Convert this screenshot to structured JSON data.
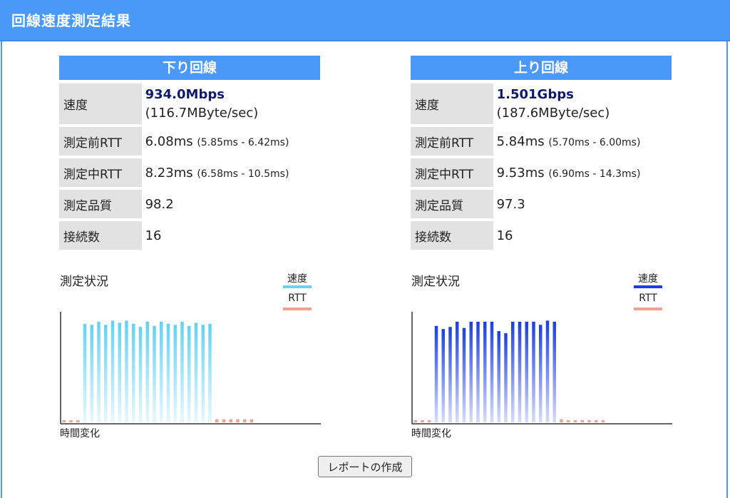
{
  "header": {
    "title": "回線速度測定結果"
  },
  "down": {
    "title": "下り回線",
    "speed_label": "速度",
    "speed_value": "934.0Mbps",
    "speed_bytes": "(116.7MByte/sec)",
    "rtt_before_label": "測定前RTT",
    "rtt_before_value": "6.08ms",
    "rtt_before_range": "(5.85ms - 6.42ms)",
    "rtt_during_label": "測定中RTT",
    "rtt_during_value": "8.23ms",
    "rtt_during_range": "(6.58ms - 10.5ms)",
    "quality_label": "測定品質",
    "quality_value": "98.2",
    "connections_label": "接続数",
    "connections_value": "16",
    "status_title": "測定状況",
    "legend_speed": "速度",
    "legend_rtt": "RTT",
    "xlabel": "時間変化"
  },
  "up": {
    "title": "上り回線",
    "speed_label": "速度",
    "speed_value": "1.501Gbps",
    "speed_bytes": "(187.6MByte/sec)",
    "rtt_before_label": "測定前RTT",
    "rtt_before_value": "5.84ms",
    "rtt_before_range": "(5.70ms - 6.00ms)",
    "rtt_during_label": "測定中RTT",
    "rtt_during_value": "9.53ms",
    "rtt_during_range": "(6.90ms - 14.3ms)",
    "quality_label": "測定品質",
    "quality_value": "97.3",
    "connections_label": "接続数",
    "connections_value": "16",
    "status_title": "測定状況",
    "legend_speed": "速度",
    "legend_rtt": "RTT",
    "xlabel": "時間変化"
  },
  "report_button": "レポートの作成",
  "colors": {
    "header": "#4a99f8",
    "down_speed": "#66d4f5",
    "up_speed": "#1a3fe0",
    "rtt": "#f2a090"
  },
  "chart_data": [
    {
      "type": "bar",
      "xlabel": "時間変化",
      "ylim": [
        0,
        100
      ],
      "series": [
        {
          "name": "速度",
          "values": [
            0,
            0,
            0,
            94,
            93,
            96,
            93,
            97,
            95,
            97,
            94,
            91,
            96,
            92,
            96,
            94,
            93,
            96,
            92,
            95,
            93,
            94,
            0,
            0,
            0,
            0,
            0,
            0
          ]
        },
        {
          "name": "RTT",
          "values": [
            2,
            2,
            2,
            2,
            3,
            3,
            3,
            3,
            3,
            3,
            3,
            3,
            4,
            3,
            3,
            3,
            3,
            3,
            3,
            3,
            3,
            3,
            3,
            3,
            3,
            3,
            3,
            3
          ]
        }
      ]
    },
    {
      "type": "bar",
      "xlabel": "時間変化",
      "ylim": [
        0,
        100
      ],
      "series": [
        {
          "name": "速度",
          "values": [
            0,
            0,
            0,
            92,
            89,
            91,
            96,
            90,
            96,
            96,
            96,
            96,
            87,
            85,
            96,
            96,
            96,
            96,
            93,
            97,
            96,
            0,
            0,
            0,
            0,
            0,
            0,
            0
          ]
        },
        {
          "name": "RTT",
          "values": [
            2,
            2,
            2,
            2,
            2,
            3,
            3,
            3,
            3,
            3,
            3,
            3,
            3,
            3,
            3,
            3,
            3,
            4,
            4,
            4,
            3,
            3,
            2,
            2,
            2,
            2,
            2,
            2
          ]
        }
      ]
    }
  ]
}
